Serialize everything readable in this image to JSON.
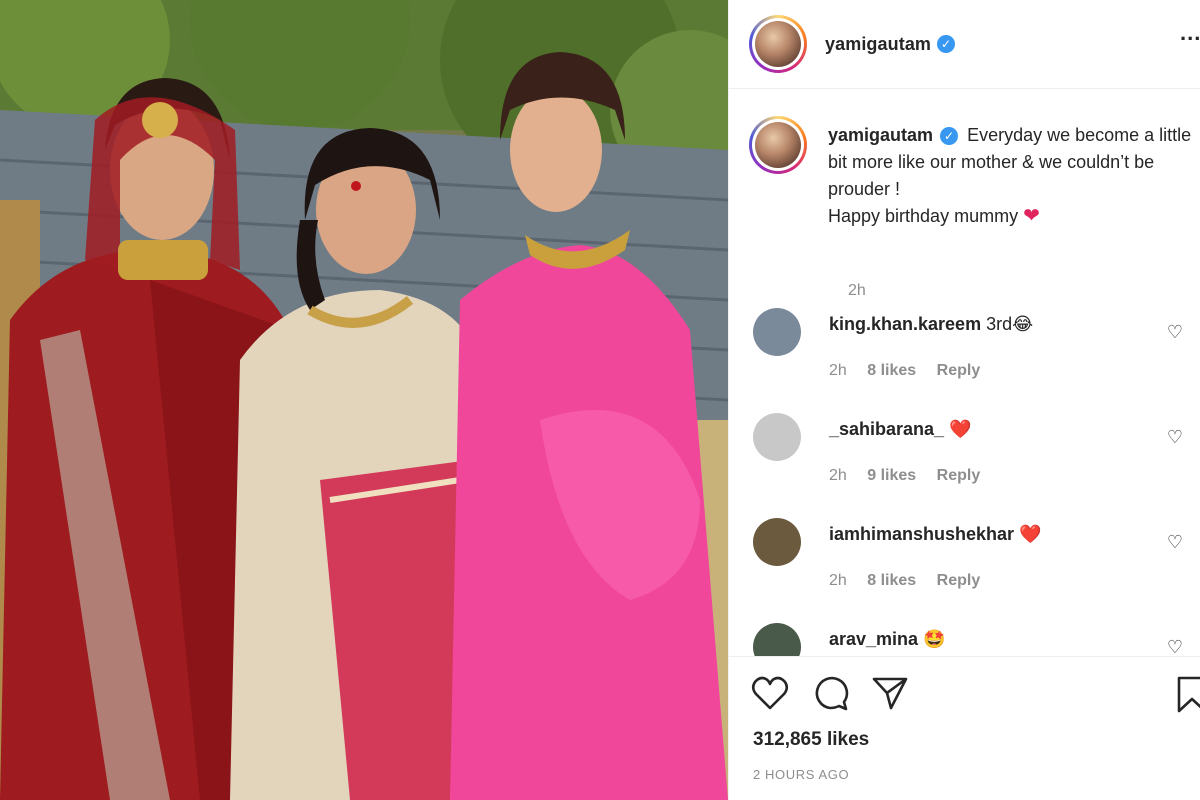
{
  "post": {
    "username": "yamigautam",
    "more_label": "...",
    "caption_username": "yamigautam",
    "caption_text": "Everyday we become a little bit more like our mother & we couldn’t be prouder !",
    "caption_line2": "Happy birthday mummy",
    "caption_time": "2h",
    "verified_glyph": "✓"
  },
  "comments": [
    {
      "username": "king.khan.kareem",
      "text": "3rd😂",
      "time": "2h",
      "likes": "8 likes",
      "reply": "Reply",
      "avatar_color": "#7a8a9a"
    },
    {
      "username": "_sahibarana_",
      "text": "❤️",
      "time": "2h",
      "likes": "9 likes",
      "reply": "Reply",
      "avatar_color": "#c8c8c8"
    },
    {
      "username": "iamhimanshushekhar",
      "text": "❤️",
      "time": "2h",
      "likes": "8 likes",
      "reply": "Reply",
      "avatar_color": "#6b5a3e"
    },
    {
      "username": "arav_mina",
      "text": "🤩",
      "time": "",
      "likes": "",
      "reply": "",
      "avatar_color": "#4a5a4a"
    }
  ],
  "footer": {
    "likes": "312,865 likes",
    "posted": "2 HOURS AGO"
  },
  "icons": [
    "heart-icon",
    "comment-icon",
    "share-icon",
    "bookmark-icon",
    "like-comment-icon"
  ],
  "colors": {
    "verified": "#3897f0",
    "heart": "#e0245e",
    "muted": "#8e8e8e"
  }
}
